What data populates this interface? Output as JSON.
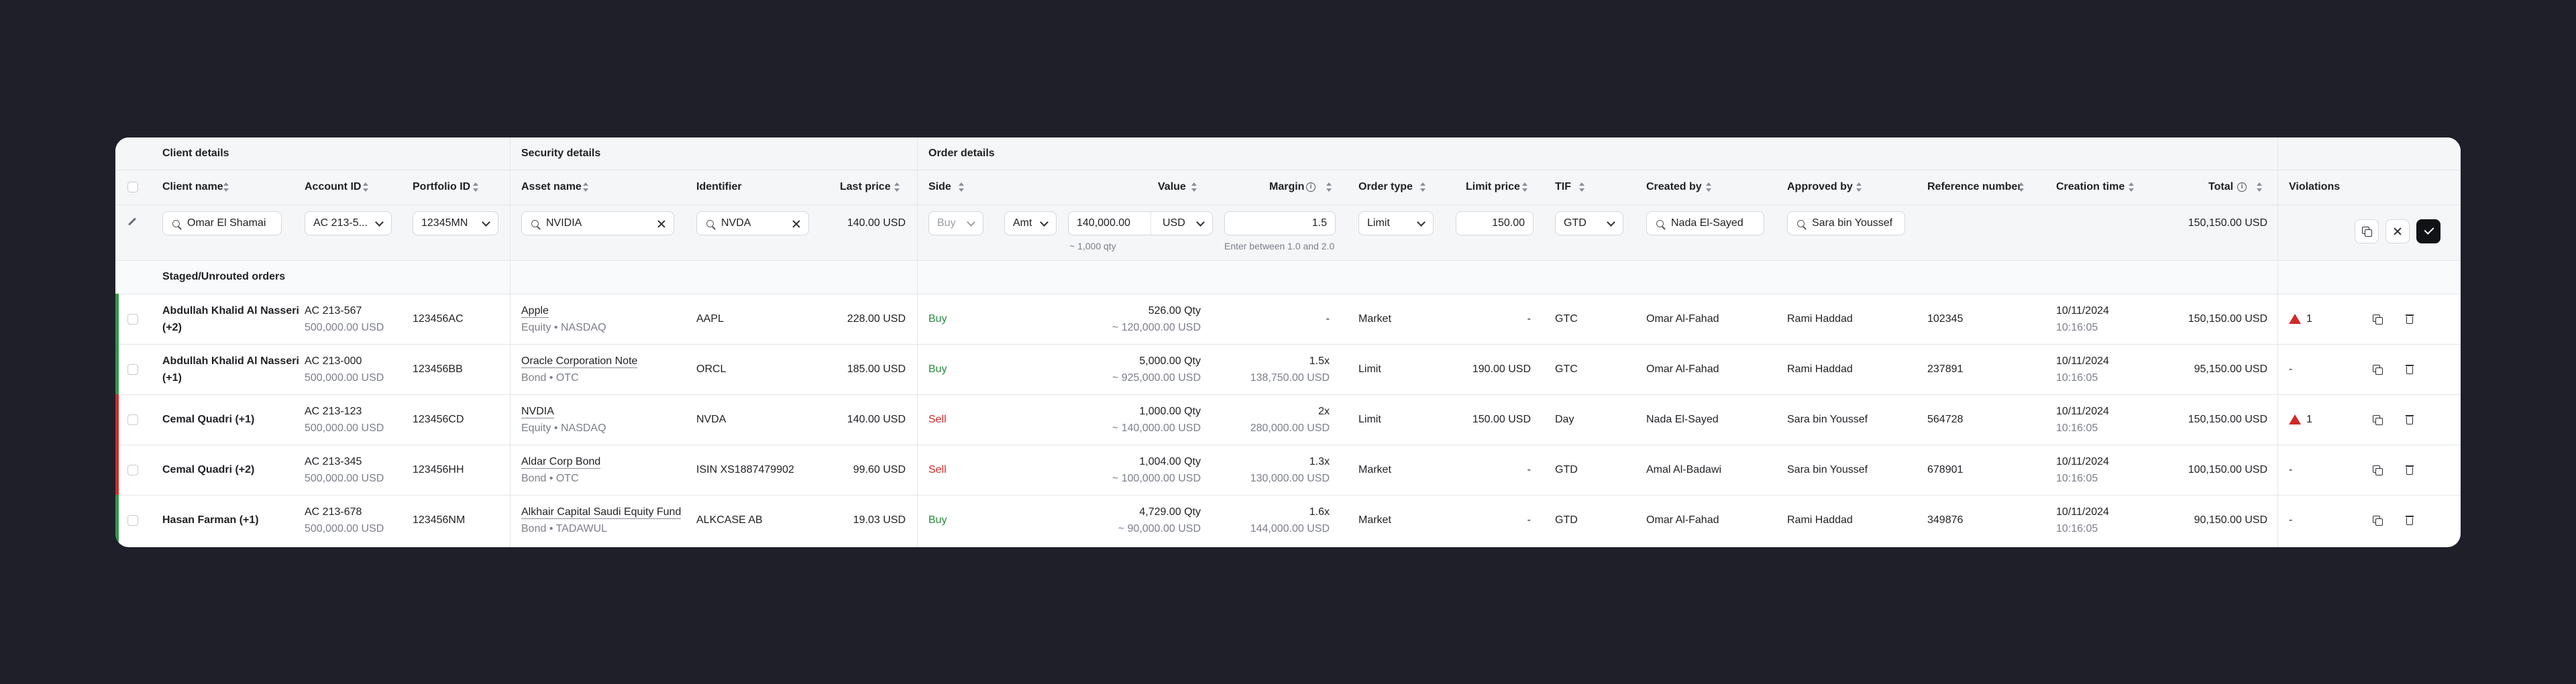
{
  "groups": {
    "client": "Client details",
    "security": "Security details",
    "order": "Order details"
  },
  "columns": {
    "client_name": "Client name",
    "account_id": "Account ID",
    "portfolio_id": "Portfolio ID",
    "asset_name": "Asset name",
    "identifier": "Identifier",
    "last_price": "Last price",
    "side": "Side",
    "value": "Value",
    "margin": "Margin",
    "order_type": "Order type",
    "limit_price": "Limit price",
    "tif": "TIF",
    "created_by": "Created by",
    "approved_by": "Approved by",
    "reference_number": "Reference number",
    "creation_time": "Creation time",
    "total": "Total",
    "violations": "Violations"
  },
  "edit_row": {
    "client_name": "Omar El Shamai",
    "account_id": "AC 213-5...",
    "portfolio_id": "12345MN",
    "asset_name": "NVIDIA",
    "identifier": "NVDA",
    "last_price": "140.00 USD",
    "side_placeholder": "Buy",
    "value_type": "Amt",
    "value_amount": "140,000.00",
    "value_currency": "USD",
    "value_qty": "~ 1,000 qty",
    "margin": "1.5",
    "margin_hint": "Enter between 1.0 and 2.0",
    "order_type": "Limit",
    "limit_price": "150.00",
    "tif": "GTD",
    "created_by": "Nada El-Sayed",
    "approved_by": "Sara bin Youssef",
    "total": "150,150.00 USD"
  },
  "section_label": "Staged/Unrouted orders",
  "rows": [
    {
      "client_line1": "Abdullah Khalid Al Nasseri",
      "client_line2": "(+2)",
      "account": "AC 213-567",
      "account_value": "500,000.00 USD",
      "portfolio": "123456AC",
      "asset": "Apple",
      "asset_sub": "Equity • NASDAQ",
      "identifier": "AAPL",
      "last_price": "228.00 USD",
      "side": "Buy",
      "value_qty": "526.00 Qty",
      "value_amt": "~ 120,000.00 USD",
      "margin": "-",
      "margin_amt": "",
      "order_type": "Market",
      "limit_price": "-",
      "tif": "GTC",
      "created_by": "Omar Al-Fahad",
      "approved_by": "Rami Haddad",
      "reference": "102345",
      "date": "10/11/2024",
      "time": "10:16:05",
      "total": "150,150.00 USD",
      "violations": "1",
      "status_color": "#2d9a45"
    },
    {
      "client_line1": "Abdullah Khalid Al Nasseri",
      "client_line2": "(+1)",
      "account": "AC 213-000",
      "account_value": "500,000.00 USD",
      "portfolio": "123456BB",
      "asset": "Oracle Corporation Note",
      "asset_sub": "Bond • OTC",
      "identifier": "ORCL",
      "last_price": "185.00 USD",
      "side": "Buy",
      "value_qty": "5,000.00 Qty",
      "value_amt": "~ 925,000.00 USD",
      "margin": "1.5x",
      "margin_amt": "138,750.00 USD",
      "order_type": "Limit",
      "limit_price": "190.00 USD",
      "tif": "GTC",
      "created_by": "Omar Al-Fahad",
      "approved_by": "Rami Haddad",
      "reference": "237891",
      "date": "10/11/2024",
      "time": "10:16:05",
      "total": "95,150.00 USD",
      "violations": "-",
      "status_color": "#2d9a45"
    },
    {
      "client_line1": "Cemal Quadri (+1)",
      "client_line2": "",
      "account": "AC 213-123",
      "account_value": "500,000.00 USD",
      "portfolio": "123456CD",
      "asset": "NVDIA",
      "asset_sub": "Equity • NASDAQ",
      "identifier": "NVDA",
      "last_price": "140.00 USD",
      "side": "Sell",
      "value_qty": "1,000.00 Qty",
      "value_amt": "~ 140,000.00 USD",
      "margin": "2x",
      "margin_amt": "280,000.00 USD",
      "order_type": "Limit",
      "limit_price": "150.00 USD",
      "tif": "Day",
      "created_by": "Nada El-Sayed",
      "approved_by": "Sara bin Youssef",
      "reference": "564728",
      "date": "10/11/2024",
      "time": "10:16:05",
      "total": "150,150.00 USD",
      "violations": "1",
      "status_color": "#d12a2a"
    },
    {
      "client_line1": "Cemal Quadri (+2)",
      "client_line2": "",
      "account": "AC 213-345",
      "account_value": "500,000.00 USD",
      "portfolio": "123456HH",
      "asset": "Aldar Corp Bond",
      "asset_sub": "Bond • OTC",
      "identifier": "ISIN XS1887479902",
      "last_price": "99.60 USD",
      "side": "Sell",
      "value_qty": "1,004.00 Qty",
      "value_amt": "~ 100,000.00 USD",
      "margin": "1.3x",
      "margin_amt": "130,000.00 USD",
      "order_type": "Market",
      "limit_price": "-",
      "tif": "GTD",
      "created_by": "Amal Al-Badawi",
      "approved_by": "Sara bin Youssef",
      "reference": "678901",
      "date": "10/11/2024",
      "time": "10:16:05",
      "total": "100,150.00 USD",
      "violations": "-",
      "status_color": "#d12a2a"
    },
    {
      "client_line1": "Hasan Farman (+1)",
      "client_line2": "",
      "account": "AC 213-678",
      "account_value": "500,000.00 USD",
      "portfolio": "123456NM",
      "asset": "Alkhair Capital Saudi Equity Fund",
      "asset_sub": "Bond • TADAWUL",
      "identifier": "ALKCASE AB",
      "last_price": "19.03 USD",
      "side": "Buy",
      "value_qty": "4,729.00 Qty",
      "value_amt": "~ 90,000.00 USD",
      "margin": "1.6x",
      "margin_amt": "144,000.00 USD",
      "order_type": "Market",
      "limit_price": "-",
      "tif": "GTD",
      "created_by": "Omar Al-Fahad",
      "approved_by": "Rami Haddad",
      "reference": "349876",
      "date": "10/11/2024",
      "time": "10:16:05",
      "total": "90,150.00 USD",
      "violations": "-",
      "status_color": "#2d9a45"
    }
  ],
  "colors": {
    "buy": "#2d8a3e",
    "sell": "#d12a2a",
    "warning": "#d12a2a",
    "confirm": "#111216"
  }
}
